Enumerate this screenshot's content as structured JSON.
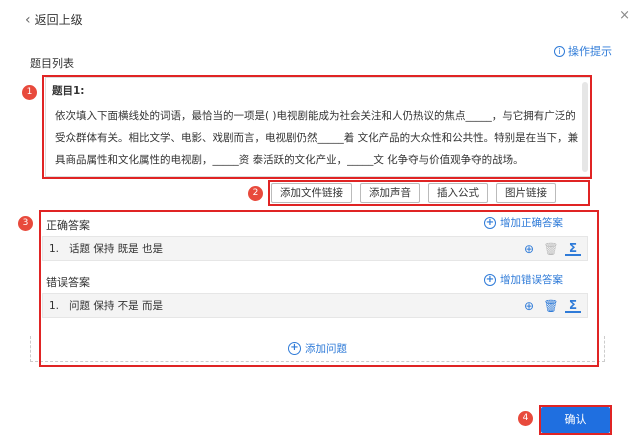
{
  "header": {
    "back_label": "返回上级",
    "close_glyph": "×"
  },
  "list_title": "题目列表",
  "tips_label": "操作提示",
  "question": {
    "head": "题目1:",
    "text": "依次填入下面横线处的词语，最恰当的一项是( )电视剧能成为社会关注和人仍热议的焦点_____，与它拥有广泛的受众群体有关。相比文学、电影、戏剧而言，电视剧仍然_____着 文化产品的大众性和公共性。特别是在当下，兼具商品属性和文化属性的电视剧，_____资 泰活跃的文化产业，_____文 化争夺与价值观争夺的战场。"
  },
  "toolbar": [
    "添加文件链接",
    "添加声音",
    "插入公式",
    "图片链接"
  ],
  "correct": {
    "label": "正确答案",
    "add_label": "增加正确答案",
    "rows": [
      {
        "num": "1.",
        "text": "话题  保持  既是  也是"
      }
    ]
  },
  "wrong": {
    "label": "错误答案",
    "add_label": "增加错误答案",
    "rows": [
      {
        "num": "1.",
        "text": "问题  保持  不是  而是"
      }
    ]
  },
  "add_question_label": "添加问题",
  "confirm_label": "确认",
  "badges": [
    "1",
    "2",
    "3",
    "4"
  ],
  "colors": {
    "accent": "#2f7bd8",
    "confirm_bg": "#1f6fe0",
    "highlight": "#e02424"
  },
  "icons": {
    "back": "chevron-left-icon",
    "tips": "info-circle-icon",
    "add": "plus-circle-icon",
    "delete": "trash-icon",
    "formula": "sigma-icon"
  }
}
